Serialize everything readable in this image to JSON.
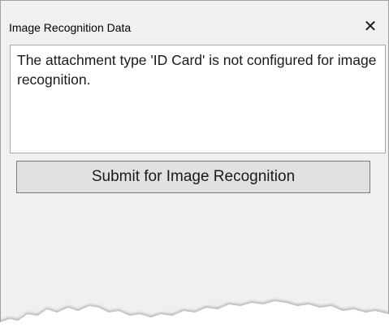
{
  "dialog": {
    "title": "Image Recognition Data",
    "close_icon_glyph": "✕",
    "message": "The attachment type 'ID Card' is not configured for image recognition.",
    "submit_label": "Submit for Image Recognition"
  },
  "colors": {
    "panel_bg": "#f0f0f0",
    "message_bg": "#ffffff",
    "button_bg": "#e1e1e1",
    "button_border": "#7a7a7a",
    "text": "#1a1a1a"
  },
  "icons": {
    "close": "close-icon"
  }
}
